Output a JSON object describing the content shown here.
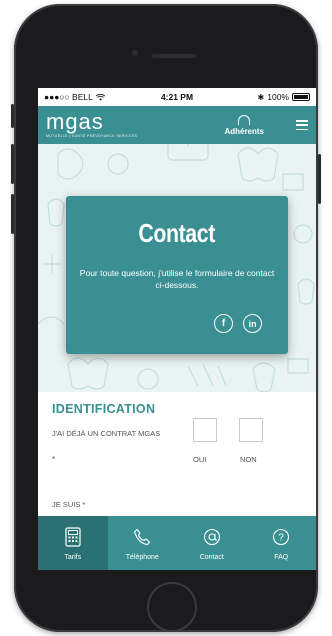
{
  "status_bar": {
    "carrier": "●●●○○ BELL",
    "time": "4:21 PM",
    "battery": "100%"
  },
  "header": {
    "logo": "mgas",
    "tagline": "MUTUELLE | SANTÉ PRÉVOYANCE SERVICES",
    "adherents_label": "Adhérents"
  },
  "contact_card": {
    "title": "Contact",
    "text": "Pour toute question, j'utilise le formulaire de contact ci-dessous.",
    "socials": [
      "f",
      "in"
    ]
  },
  "form": {
    "section_title": "IDENTIFICATION",
    "question_contract": "J'AI DÉJÀ UN CONTRAT MGAS",
    "required_mark": "*",
    "option_yes": "OUI",
    "option_no": "NON",
    "question_iam": "JE SUIS *"
  },
  "tabbar": {
    "items": [
      {
        "label": "Tarifs",
        "icon": "calculator-icon",
        "active": true
      },
      {
        "label": "Téléphone",
        "icon": "phone-icon",
        "active": false
      },
      {
        "label": "Contact",
        "icon": "at-icon",
        "active": false
      },
      {
        "label": "FAQ",
        "icon": "question-icon",
        "active": false
      }
    ]
  },
  "colors": {
    "brand": "#3a8f92",
    "brand_dark": "#2b7072",
    "hero_bg": "#eaf3f3"
  }
}
